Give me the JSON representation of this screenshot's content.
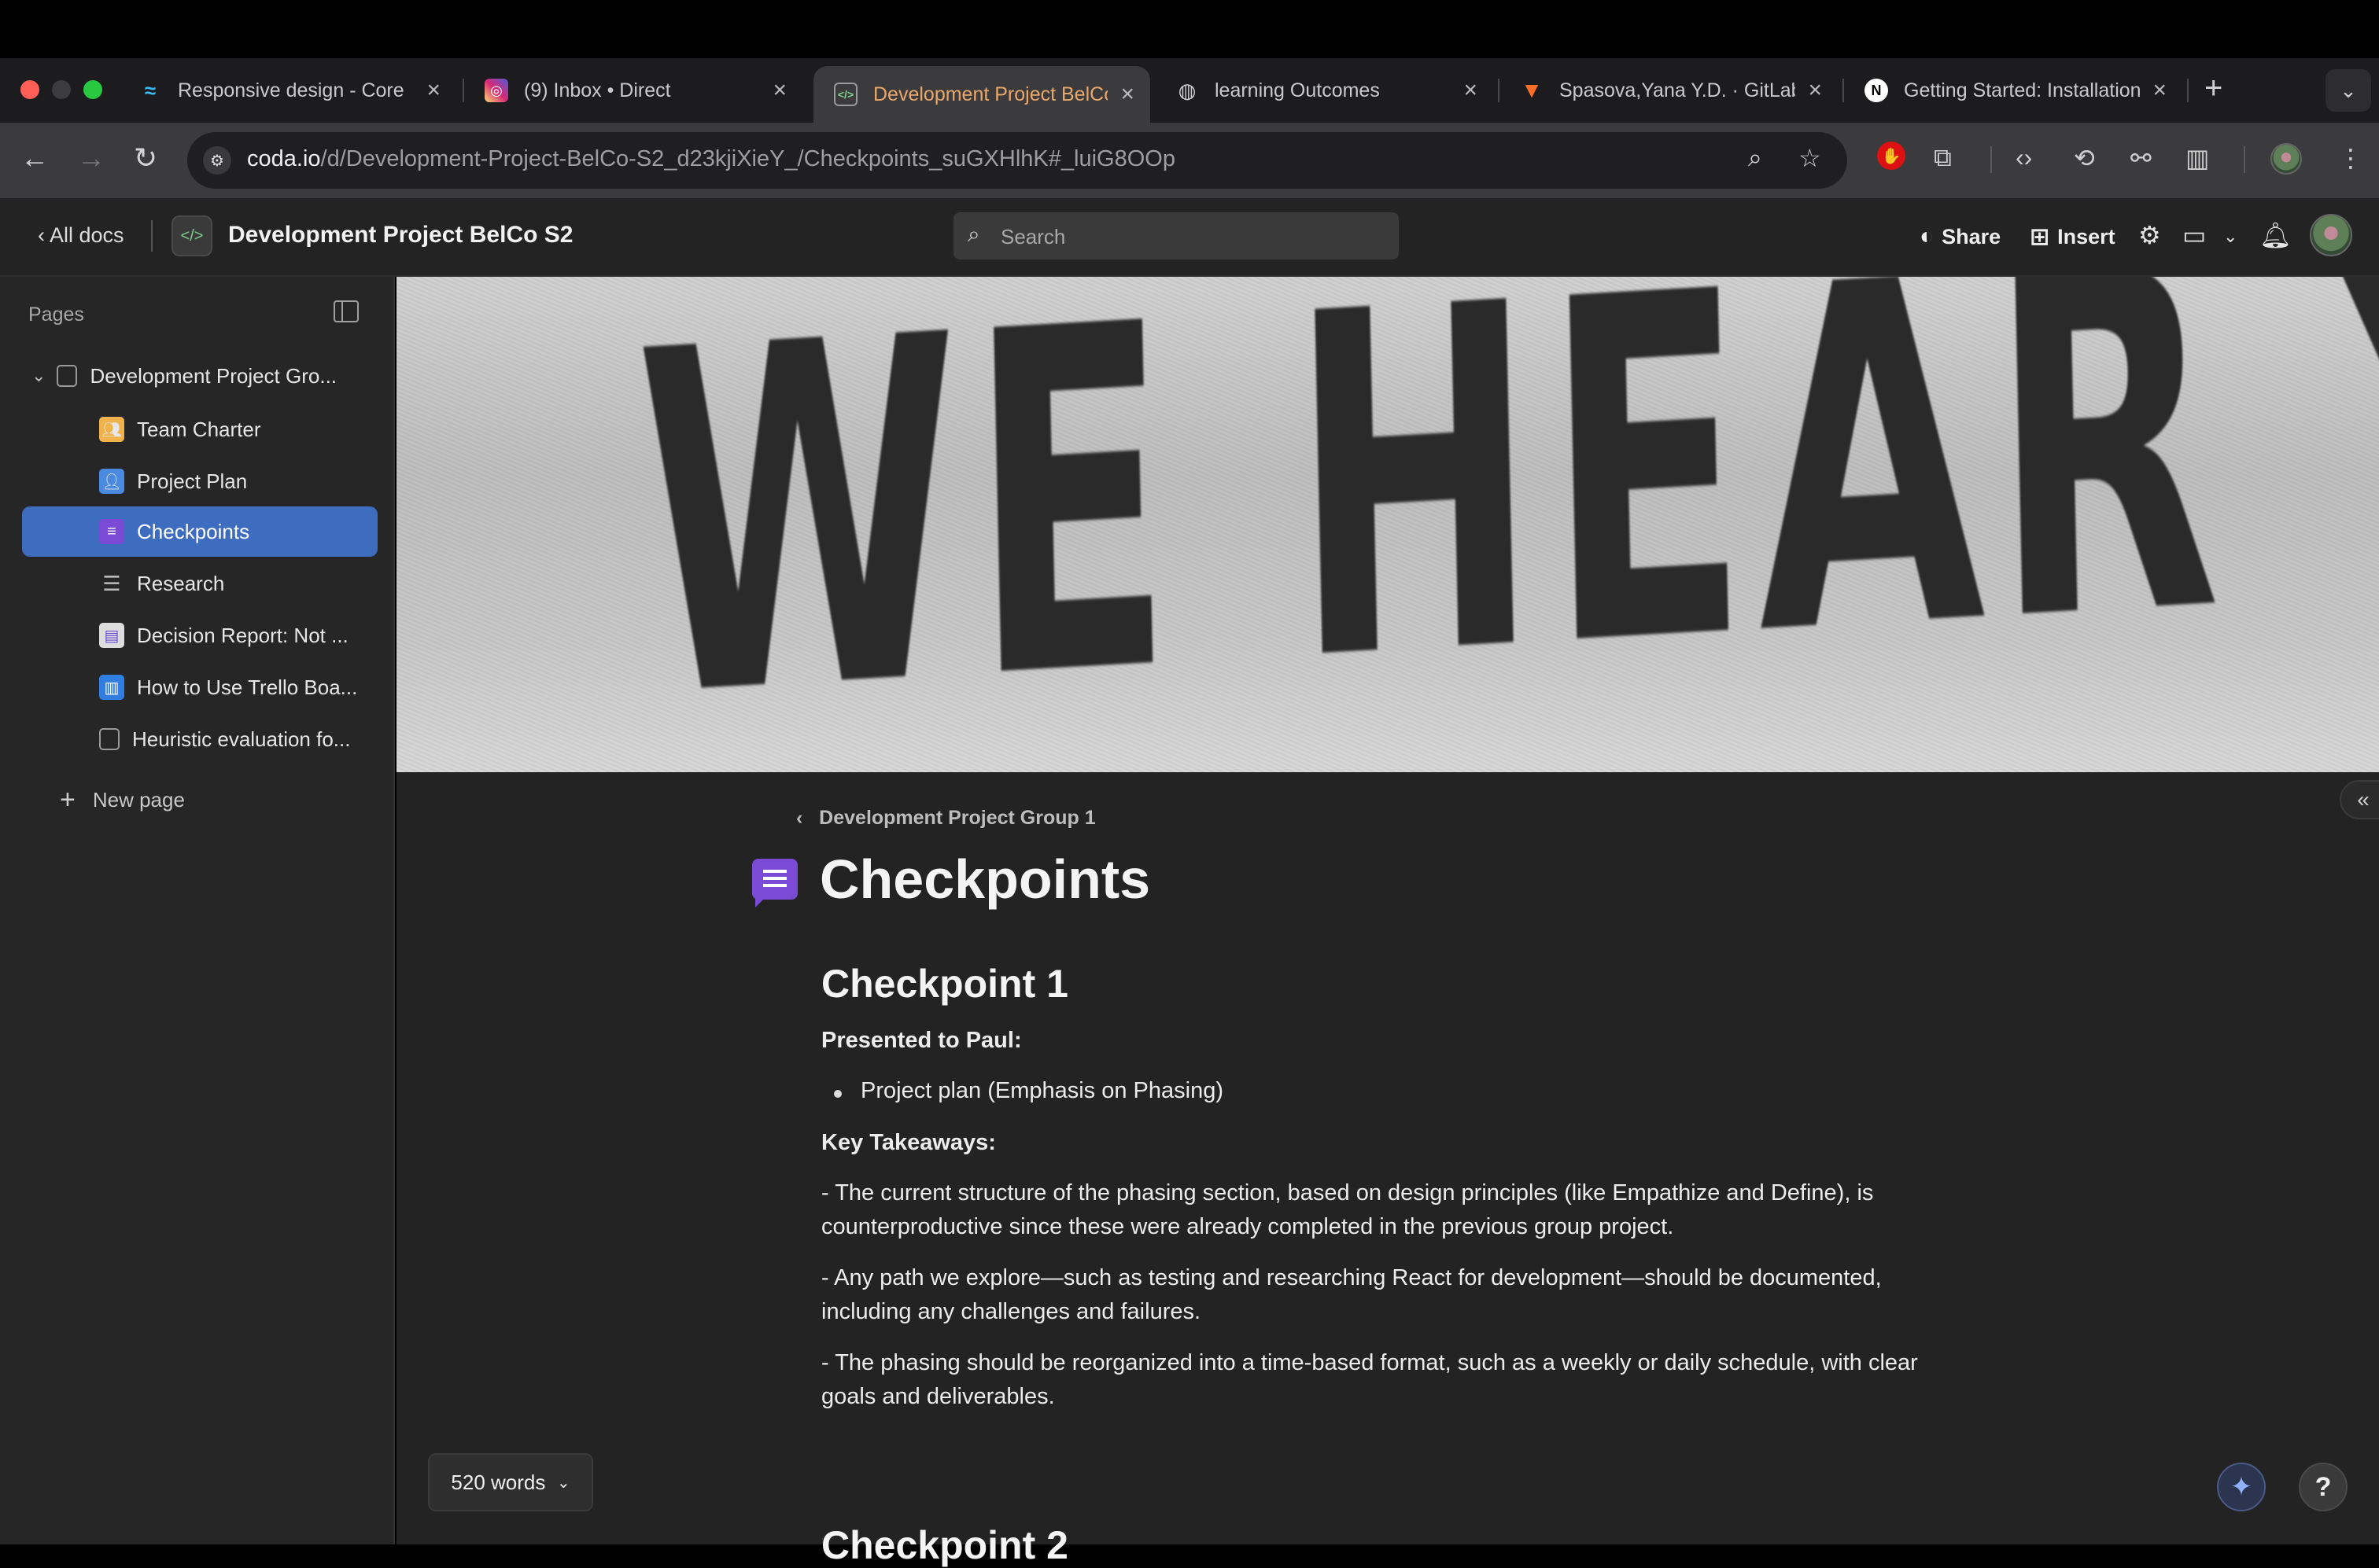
{
  "browser": {
    "tabs": [
      {
        "title": "Responsive design - Core",
        "icon": "tailwind-icon",
        "color": "#38bdf8"
      },
      {
        "title": "(9) Inbox • Direct",
        "icon": "instagram-icon",
        "color": "#e1306c"
      },
      {
        "title": "Development Project BelCo",
        "icon": "coda-doc-icon",
        "color": "#7fd08f",
        "active": true
      },
      {
        "title": "learning Outcomes",
        "icon": "globe-icon",
        "color": "#cfcfcf"
      },
      {
        "title": "Spasova,Yana Y.D. · GitLab",
        "icon": "gitlab-icon",
        "color": "#fc6d26"
      },
      {
        "title": "Getting Started: Installation",
        "icon": "nextjs-icon",
        "color": "#ffffff"
      }
    ],
    "url_domain": "coda.io",
    "url_path": "/d/Development-Project-BelCo-S2_d23kjiXieY_/Checkpoints_suGXHlhK#_luiG8OOp"
  },
  "header": {
    "all_docs": "All docs",
    "doc_title": "Development Project BelCo S2",
    "search_placeholder": "Search",
    "share": "Share",
    "insert": "Insert"
  },
  "sidebar": {
    "pages_label": "Pages",
    "parent": "Development Project Gro...",
    "items": [
      {
        "label": "Team Charter",
        "icon": "people-icon"
      },
      {
        "label": "Project Plan",
        "icon": "team-icon"
      },
      {
        "label": "Checkpoints",
        "icon": "chat-icon",
        "active": true
      },
      {
        "label": "Research",
        "icon": "list-icon"
      },
      {
        "label": "Decision Report: Not ...",
        "icon": "report-icon"
      },
      {
        "label": "How to Use Trello Boa...",
        "icon": "trello-icon"
      },
      {
        "label": "Heuristic evaluation fo...",
        "icon": "doc-icon"
      }
    ],
    "new_page": "New page"
  },
  "banner": {
    "text": "WE HEAR YOU."
  },
  "page": {
    "breadcrumb": "Development Project Group 1",
    "title": "Checkpoints",
    "section1_heading": "Checkpoint 1",
    "presented_label": "Presented to Paul:",
    "presented_item": "Project plan (Emphasis on Phasing)",
    "takeaways_label": "Key Takeaways:",
    "takeaway_1": "- The current structure of the phasing section, based on design principles (like Empathize and Define), is counterproductive since these were already completed in the previous group project.",
    "takeaway_2": "- Any path we explore—such as testing and researching React for development—should be documented, including any challenges and failures.",
    "takeaway_3": "- The phasing should be reorganized into a time-based format, such as a weekly or daily schedule, with clear goals and deliverables.",
    "section2_heading": "Checkpoint 2"
  },
  "footer": {
    "word_count": "520 words"
  },
  "colors": {
    "accent": "#3e6cbf",
    "active_tab_text": "#e9a86a",
    "page_icon": "#7b4bd6"
  }
}
